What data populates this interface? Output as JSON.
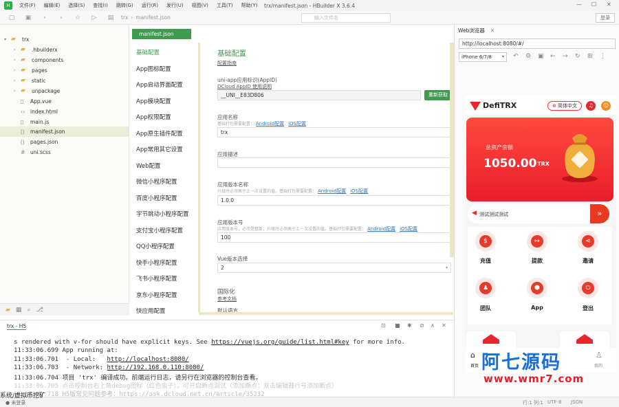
{
  "window": {
    "title": "trx/manifest.json - HBuilder X 3.6.4"
  },
  "menu": [
    "文件(F)",
    "编辑(E)",
    "选择(S)",
    "查找(I)",
    "跳转(G)",
    "运行(R)",
    "发行(U)",
    "视图(V)",
    "工具(T)",
    "帮助(Y)"
  ],
  "toolbar": {
    "breadcrumb": [
      "trx",
      "manifest.json"
    ],
    "file_search_placeholder": "输入文件名",
    "login_label": "登录"
  },
  "explorer": {
    "root": "trx",
    "items": [
      ".hbuilderx",
      "components",
      "pages",
      "static",
      "unpackage",
      "App.vue",
      "index.html",
      "main.js",
      "manifest.json",
      "pages.json",
      "uni.scss"
    ]
  },
  "editor": {
    "tab": "manifest.json",
    "nav": [
      "基础配置",
      "App图标配置",
      "App启动界面配置",
      "App模块配置",
      "App权限配置",
      "App原生插件配置",
      "App常用其它设置",
      "Web配置",
      "微信小程序配置",
      "百度小程序配置",
      "字节跳动小程序配置",
      "支付宝小程序配置",
      "QQ小程序配置",
      "快手小程序配置",
      "飞书小程序配置",
      "京东小程序配置",
      "快应用配置"
    ],
    "form": {
      "title": "基础配置",
      "guide_link": "配置指南",
      "appid_label": "uni-app应用标识(AppID)",
      "appid_link": "DCloud AppID 使用说明",
      "appid_value": "__UNI__E83D806",
      "regen_button": "重新获取",
      "name_label": "应用名称",
      "name_hint": "基础打包需要配置：",
      "android_link": "Android配置",
      "ios_link": "iOS配置",
      "name_value": "trx",
      "desc_label": "应用描述",
      "desc_value": "",
      "vname_label": "应用版本名称",
      "vname_hint": "升级时必须高于上一次设置的值。基础打包需要配置：",
      "vname_value": "1.0.0",
      "vcode_label": "应用版本号",
      "vcode_hint": "应用版本号，必须是整数；升级时必须高于上一次设置的值。基础打包需要配置：",
      "vcode_value": "100",
      "vue_label": "Vue版本选择",
      "vue_value": "2",
      "i18n_title": "国际化",
      "i18n_link": "参考文档",
      "default_lang_label": "默认语言"
    }
  },
  "console": {
    "tab": "trx - H5",
    "lines": [
      {
        "time": "",
        "text": "s rendered with v-for should have explicit keys. See ",
        "link": "https://vuejs.org/guide/list.html#key",
        "after": " for more info."
      },
      {
        "time": "11:33:06.699",
        "text": "  App running at:",
        "link": "",
        "after": ""
      },
      {
        "time": "11:33:06.701",
        "text": "  - Local:   ",
        "link": "http://localhost:8080/",
        "after": ""
      },
      {
        "time": "11:33:06.703",
        "text": "  - Network: ",
        "link": "http://192.168.0.110:8080/",
        "after": ""
      },
      {
        "time": "11:33:06.704",
        "text": " 项目 'trx' 编译成功。前端运行日志，请另行在浏览器的控制台查看。",
        "link": "",
        "after": ""
      },
      {
        "time": "11:33:06.705",
        "text": " 点击控制台右上角debug图标（红色虫子），可开启断点调试（添加断点：双击编辑器行号添加断点）",
        "link": "",
        "after": ""
      },
      {
        "time": "11:33:06.718",
        "text": " H5版常见问题参考：",
        "link": "https://ask.dcloud.net.cn/article/35232",
        "after": ""
      }
    ]
  },
  "status": {
    "left": "未登录",
    "pos": "行:1  列:1",
    "enc": "UTF-8",
    "lang": "JSON"
  },
  "browser": {
    "tab": "Web浏览器",
    "url": "http://localhost:8080/#/",
    "device": "iPhone 6/7/8",
    "app": {
      "brand": "DefiTRX",
      "lang_pill": "简体中文",
      "balance_label": "总资产余额",
      "balance_value": "1050.00",
      "balance_unit": "TRX",
      "ticker": "测试测试测试",
      "grid": [
        "充值",
        "提款",
        "邀请",
        "团队",
        "App",
        "登出"
      ],
      "tabs": [
        "首页",
        "我的"
      ]
    }
  },
  "watermark": {
    "cn": "阿七源码",
    "url": "www.wmr7.com",
    "left": "系统/虚拟币挖矿"
  },
  "colors": {
    "accent": "#3e9b4f",
    "app_red": "#e8262e",
    "link": "#2d79c7"
  }
}
